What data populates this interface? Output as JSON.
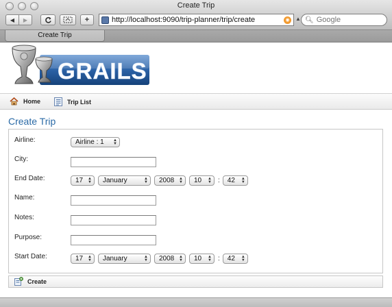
{
  "window": {
    "title": "Create Trip"
  },
  "toolbar": {
    "back_label": "◀",
    "forward_label": "▶",
    "reload_label": "C",
    "add_label": "+",
    "url": "http://localhost:9090/trip-planner/trip/create",
    "search_placeholder": "Google"
  },
  "tab": {
    "label": "Create Trip"
  },
  "logo": {
    "text": "GRAILS"
  },
  "nav": {
    "home_label": "Home",
    "trip_list_label": "Trip List"
  },
  "page": {
    "heading": "Create Trip"
  },
  "form": {
    "airline": {
      "label": "Airline:",
      "value": "Airline : 1"
    },
    "city": {
      "label": "City:",
      "value": ""
    },
    "end_date": {
      "label": "End Date:",
      "day": "17",
      "month": "January",
      "year": "2008",
      "hour": "10",
      "time_sep": ":",
      "minute": "42"
    },
    "name": {
      "label": "Name:",
      "value": ""
    },
    "notes": {
      "label": "Notes:",
      "value": ""
    },
    "purpose": {
      "label": "Purpose:",
      "value": ""
    },
    "start_date": {
      "label": "Start Date:",
      "day": "17",
      "month": "January",
      "year": "2008",
      "hour": "10",
      "time_sep": ":",
      "minute": "42"
    }
  },
  "buttons": {
    "create_label": "Create"
  },
  "icons": {
    "home": "home-icon",
    "trip_list": "list-icon",
    "create": "create-icon",
    "search": "search-icon",
    "site": "site-icon",
    "rss": "rss-icon"
  },
  "colors": {
    "heading": "#2a6aa6",
    "logo_bg": "#1c4f8e"
  }
}
